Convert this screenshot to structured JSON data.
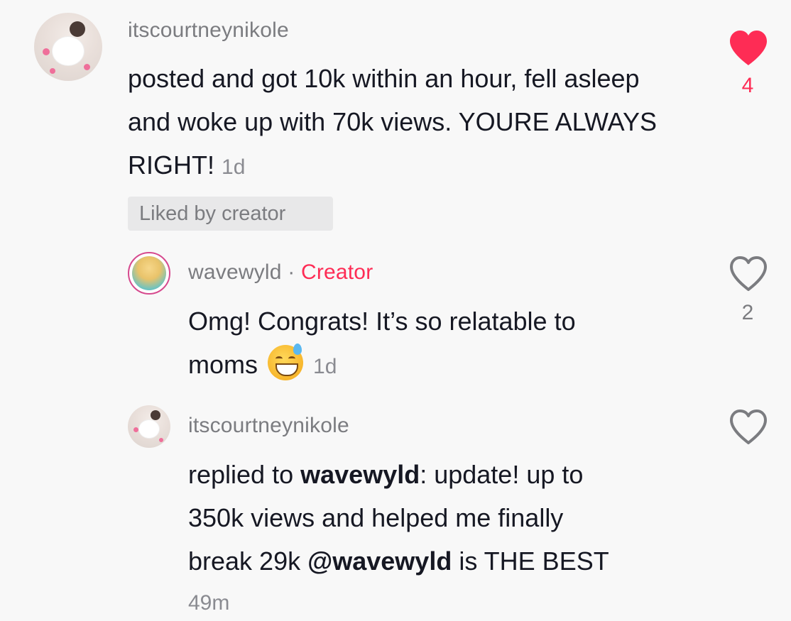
{
  "comments": [
    {
      "username": "itscourtneynikole",
      "text": "posted and got 10k within an hour, fell asleep and woke up with 70k views. YOURE ALWAYS RIGHT!",
      "time": "1d",
      "badge": "Liked by creator",
      "likes": "4",
      "liked": true
    }
  ],
  "replies": [
    {
      "username": "wavewyld",
      "separator": "·",
      "role": "Creator",
      "text_line1": "Omg! Congrats! It’s so relatable to",
      "text_line2": "moms",
      "emoji": "sweat-smile-emoji",
      "time": "1d",
      "likes": "2",
      "liked": false
    },
    {
      "username": "itscourtneynikole",
      "replied_prefix": "replied to",
      "replied_to": "wavewyld",
      "text_after_colon": ": update! up to",
      "text_line2": "350k views and helped me finally",
      "text_line3_start": "break 29k",
      "mention": "@wavewyld",
      "text_line3_end": "is THE BEST",
      "time": "49m",
      "liked": false
    }
  ],
  "colors": {
    "accent": "#fe2c55",
    "text": "#161823",
    "muted": "#7b7c80",
    "background": "#f8f8f8"
  }
}
